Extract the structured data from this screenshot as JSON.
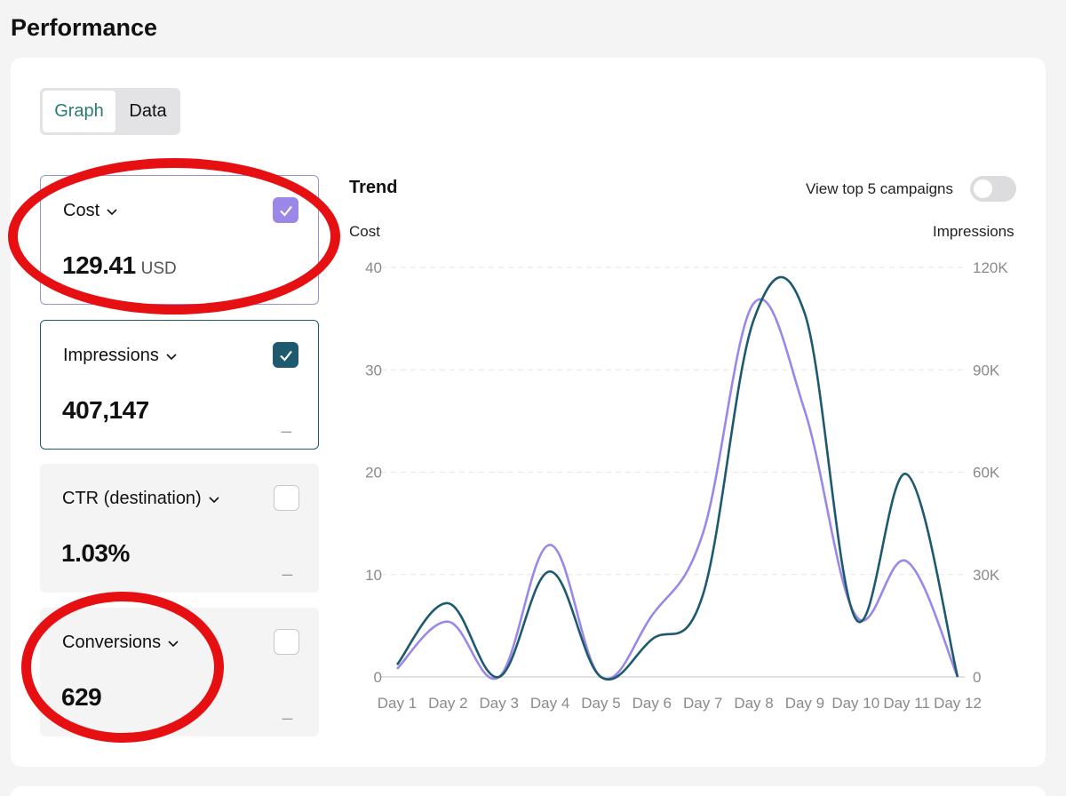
{
  "page": {
    "title": "Performance"
  },
  "view_toggle": {
    "graph_label": "Graph",
    "data_label": "Data",
    "selected": "Graph"
  },
  "metrics": [
    {
      "label": "Cost",
      "value": "129.41",
      "unit": "USD",
      "checked": true,
      "dash": "_"
    },
    {
      "label": "Impressions",
      "value": "407,147",
      "unit": "",
      "checked": true,
      "dash": "_"
    },
    {
      "label": "CTR (destination)",
      "value": "1.03%",
      "unit": "",
      "checked": false,
      "dash": "_"
    },
    {
      "label": "Conversions",
      "value": "629",
      "unit": "",
      "checked": false,
      "dash": "_"
    }
  ],
  "trend": {
    "title": "Trend",
    "top5_label": "View top 5 campaigns",
    "top5_enabled": false,
    "left_axis_title": "Cost",
    "right_axis_title": "Impressions"
  },
  "colors": {
    "cost": "#9a88e8",
    "impressions": "#1d5a70",
    "accent": "#2a7c72",
    "annotation": "#e61012"
  },
  "chart_data": {
    "type": "line",
    "x": [
      "Day 1",
      "Day 2",
      "Day 3",
      "Day 4",
      "Day 5",
      "Day 6",
      "Day 7",
      "Day 8",
      "Day 9",
      "Day 10",
      "Day 11",
      "Day 12"
    ],
    "y_left": {
      "label": "Cost",
      "range": [
        0,
        40
      ],
      "ticks": [
        "0",
        "10",
        "20",
        "30",
        "40"
      ]
    },
    "y_right": {
      "label": "Impressions",
      "range": [
        0,
        120000
      ],
      "ticks": [
        "0",
        "30K",
        "60K",
        "90K",
        "120K"
      ]
    },
    "grid": true,
    "series": [
      {
        "name": "Cost",
        "axis": "left",
        "color": "#9a88e8",
        "values": [
          0.8,
          5.4,
          0.0,
          12.9,
          0.0,
          6.0,
          14.0,
          36.5,
          26.0,
          6.0,
          11.3,
          0.0
        ]
      },
      {
        "name": "Impressions",
        "axis": "right",
        "color": "#1d5a70",
        "values": [
          3600,
          21600,
          0,
          30900,
          0,
          11000,
          24000,
          104700,
          106500,
          17000,
          59400,
          0
        ]
      }
    ]
  }
}
